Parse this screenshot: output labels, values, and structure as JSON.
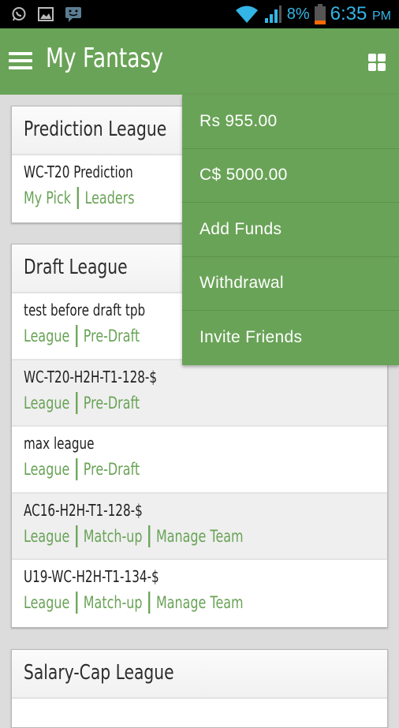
{
  "status_bar": {
    "notification_icons": [
      "whatsapp-icon",
      "gallery-icon",
      "message-icon"
    ],
    "battery_percent": "8%",
    "time": "6:35",
    "ampm": "PM",
    "accent_color": "#33b5e5"
  },
  "app_bar": {
    "title": "My Fantasy",
    "menu_icon": "hamburger-menu-icon",
    "action_icon": "grid-icon",
    "color": "#69a357"
  },
  "sections": [
    {
      "title": "Prediction League",
      "rows": [
        {
          "name": "WC-T20 Prediction",
          "links": [
            "My Pick",
            "Leaders"
          ]
        }
      ]
    },
    {
      "title": "Draft League",
      "rows": [
        {
          "name": "test before draft tpb",
          "links": [
            "League",
            "Pre-Draft"
          ]
        },
        {
          "name": "WC-T20-H2H-T1-128-$",
          "links": [
            "League",
            "Pre-Draft"
          ]
        },
        {
          "name": "max league",
          "links": [
            "League",
            "Pre-Draft"
          ]
        },
        {
          "name": "AC16-H2H-T1-128-$",
          "links": [
            "League",
            "Match-up",
            "Manage Team"
          ]
        },
        {
          "name": "U19-WC-H2H-T1-134-$",
          "links": [
            "League",
            "Match-up",
            "Manage Team"
          ]
        }
      ]
    },
    {
      "title": "Salary-Cap League",
      "rows": []
    }
  ],
  "dropdown_menu": {
    "items": [
      "Rs 955.00",
      "C$ 5000.00",
      "Add Funds",
      "Withdrawal",
      "Invite Friends"
    ]
  }
}
